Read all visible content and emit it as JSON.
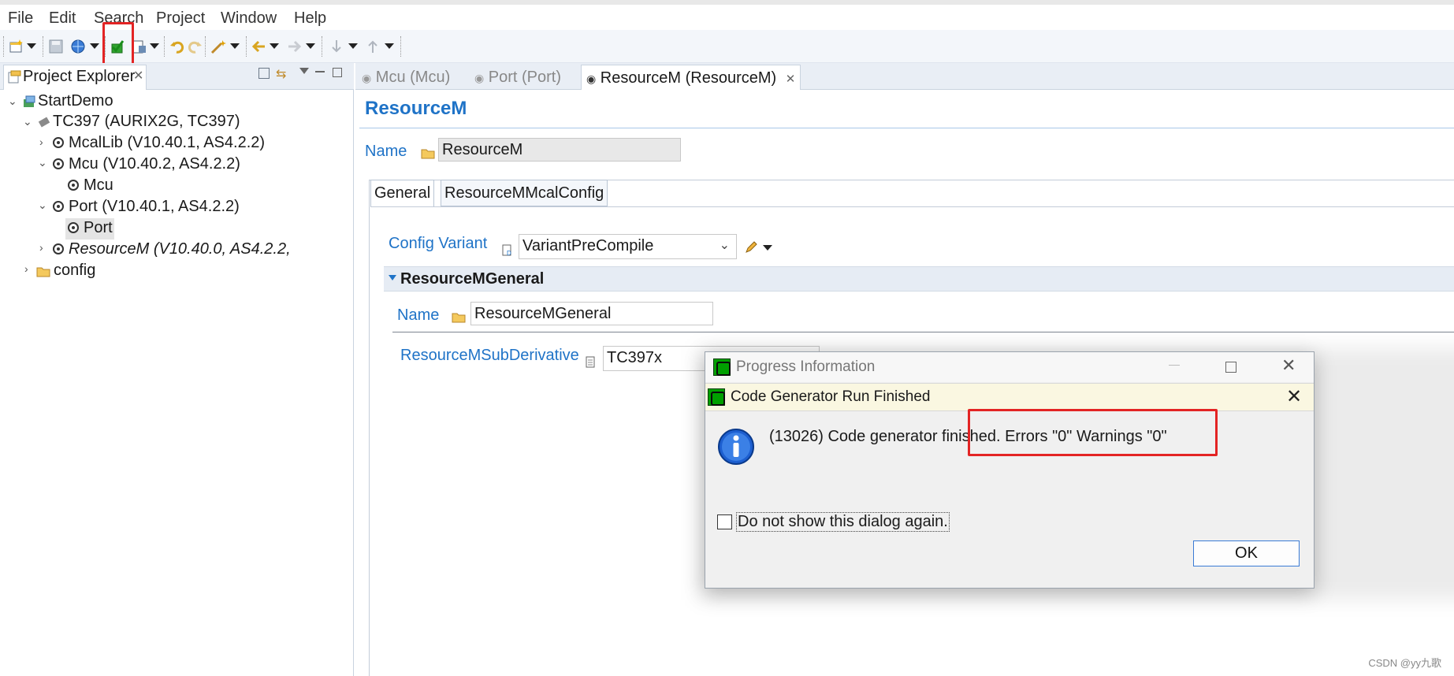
{
  "menu": {
    "items": [
      {
        "label": "File"
      },
      {
        "label": "Edit"
      },
      {
        "label": "Search"
      },
      {
        "label": "Project"
      },
      {
        "label": "Window"
      },
      {
        "label": "Help"
      }
    ]
  },
  "toolbar": {
    "icons": [
      "new-icon",
      "save-icon",
      "globe-icon",
      "generate-code-icon",
      "build-icon",
      "undo-icon",
      "redo-icon",
      "wand-icon",
      "back-icon",
      "forward-icon",
      "down-arrow-icon",
      "up-arrow-icon"
    ]
  },
  "project_explorer": {
    "tab_label": "Project Explorer",
    "tree": [
      {
        "label": "StartDemo"
      },
      {
        "label": "TC397 (AURIX2G, TC397)"
      },
      {
        "label": "McalLib (V10.40.1, AS4.2.2)"
      },
      {
        "label": "Mcu (V10.40.2, AS4.2.2)"
      },
      {
        "label": "Mcu"
      },
      {
        "label": "Port (V10.40.1, AS4.2.2)"
      },
      {
        "label": "Port"
      },
      {
        "label": "ResourceM (V10.40.0, AS4.2.2,"
      },
      {
        "label": "config"
      }
    ]
  },
  "editor": {
    "tabs": [
      {
        "label": "Mcu (Mcu)"
      },
      {
        "label": "Port (Port)"
      },
      {
        "label": "ResourceM (ResourceM)"
      }
    ],
    "title": "ResourceM",
    "name_label": "Name",
    "name_value": "ResourceM",
    "subtabs": [
      {
        "label": "General"
      },
      {
        "label": "ResourceMMcalConfig"
      }
    ],
    "config_variant_label": "Config Variant",
    "config_variant_value": "VariantPreCompile",
    "section_title": "ResourceMGeneral",
    "section_name_label": "Name",
    "section_name_value": "ResourceMGeneral",
    "subderivative_label": "ResourceMSubDerivative",
    "subderivative_value": "TC397x"
  },
  "dialog": {
    "outer_title": "Progress Information",
    "inner_title": "Code Generator Run Finished",
    "message": "(13026) Code generator finished. Errors \"0\" Warnings \"0\"",
    "checkbox_label": "Do not show this dialog again.",
    "ok_label": "OK"
  },
  "watermark": "CSDN @yy九歌",
  "colors": {
    "accent_blue": "#1f73c7",
    "highlight_red": "#e32424",
    "dialog_title_bg": "#faf7e1"
  }
}
